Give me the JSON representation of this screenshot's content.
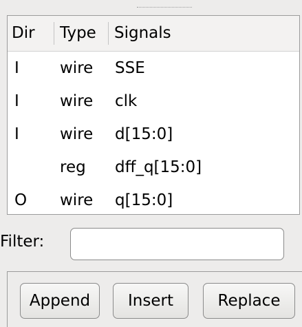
{
  "table": {
    "columns": [
      "Dir",
      "Type",
      "Signals"
    ],
    "rows": [
      {
        "dir": "I",
        "type": "wire",
        "signal": "SSE"
      },
      {
        "dir": "I",
        "type": "wire",
        "signal": "clk"
      },
      {
        "dir": "I",
        "type": "wire",
        "signal": "d[15:0]"
      },
      {
        "dir": "",
        "type": "reg",
        "signal": "dff_q[15:0]"
      },
      {
        "dir": "O",
        "type": "wire",
        "signal": "q[15:0]"
      }
    ]
  },
  "filter": {
    "label": "Filter:",
    "value": ""
  },
  "buttons": {
    "append": "Append",
    "insert": "Insert",
    "replace": "Replace"
  }
}
